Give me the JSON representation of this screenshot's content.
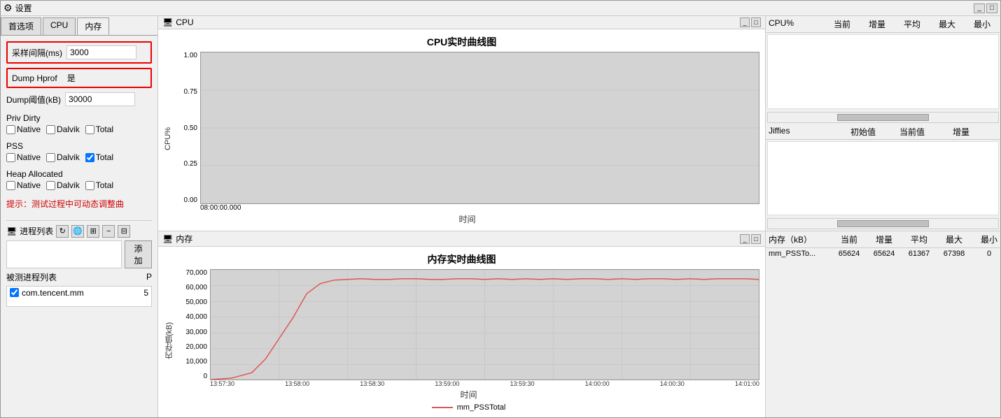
{
  "app": {
    "title": "设置",
    "cpu_window_title": "CPU",
    "mem_window_title": "内存"
  },
  "tabs": [
    {
      "label": "首选项",
      "active": false
    },
    {
      "label": "CPU",
      "active": false
    },
    {
      "label": "内存",
      "active": true
    }
  ],
  "settings": {
    "sample_interval_label": "采样间隔(ms)",
    "sample_interval_value": "3000",
    "dump_hprof_label": "Dump Hprof",
    "dump_hprof_value": "是",
    "dump_threshold_label": "Dump阈值(kB)",
    "dump_threshold_value": "30000",
    "priv_dirty_label": "Priv Dirty",
    "pss_label": "PSS",
    "heap_allocated_label": "Heap Allocated",
    "checkboxes": {
      "native": "Native",
      "dalvik": "Dalvik",
      "total": "Total"
    },
    "hint_text": "提示：测试过程中可动态调整曲",
    "process_list_label": "进程列表",
    "add_btn_label": "添加",
    "monitored_label": "被测进程列表",
    "monitored_col": "P",
    "monitored_item": "com.tencent.mm",
    "monitored_value": "5"
  },
  "cpu_chart": {
    "title": "CPU实时曲线图",
    "y_label": "CPU%",
    "x_label": "时间",
    "x_start": "08:00:00.000",
    "y_ticks": [
      "1.00",
      "0.75",
      "0.50",
      "0.25",
      "0.00"
    ],
    "table": {
      "headers": [
        "CPU%",
        "当前",
        "增量",
        "平均",
        "最大",
        "最小"
      ],
      "jiffies_headers": [
        "Jiffies",
        "初始值",
        "当前值",
        "增量"
      ]
    }
  },
  "mem_chart": {
    "title": "内存实时曲线图",
    "y_label": "内存值(kB)",
    "x_label": "时间",
    "x_ticks": [
      "13:57:30",
      "13:58:00",
      "13:58:30",
      "13:59:00",
      "13:59:30",
      "14:00:00",
      "14:00:30",
      "14:01:00"
    ],
    "y_ticks": [
      "70,000",
      "60,000",
      "50,000",
      "40,000",
      "30,000",
      "20,000",
      "10,000",
      "0"
    ],
    "legend": "mm_PSSTotal",
    "table": {
      "headers": [
        "内存（kB）",
        "当前",
        "增量",
        "平均",
        "最大",
        "最小"
      ],
      "rows": [
        {
          "name": "mm_PSSTo...",
          "current": "65624",
          "delta": "65624",
          "avg": "61367",
          "max": "67398",
          "min": "0"
        }
      ]
    }
  }
}
